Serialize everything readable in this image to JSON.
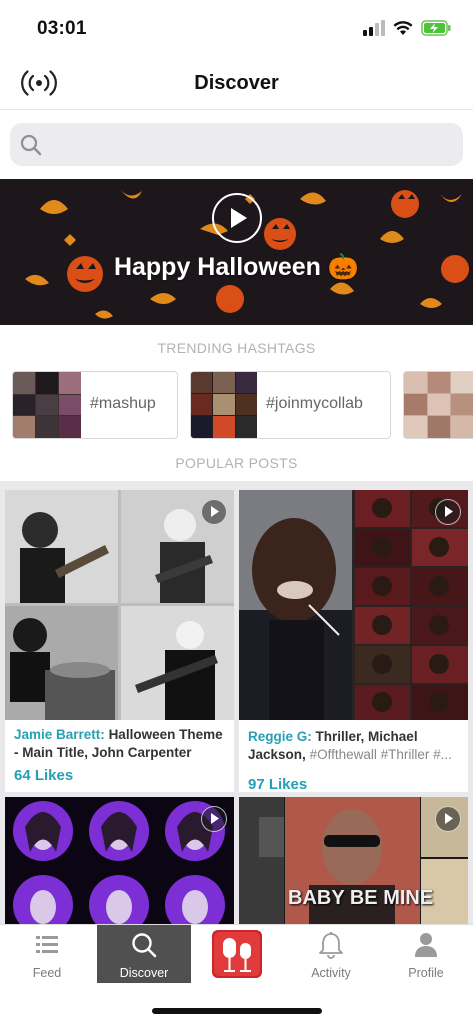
{
  "status": {
    "time": "03:01"
  },
  "nav": {
    "title": "Discover"
  },
  "search": {
    "placeholder": ""
  },
  "banner": {
    "title": "Happy Halloween 🎃"
  },
  "sections": {
    "trending": "TRENDING HASHTAGS",
    "popular": "POPULAR POSTS"
  },
  "hashtags": [
    {
      "tag": "#mashup"
    },
    {
      "tag": "#joinmycollab"
    }
  ],
  "posts": [
    {
      "user": "Jamie Barrett:",
      "title": "Halloween Theme - Main Title, John Carpenter",
      "tags": "",
      "likes": "64 Likes"
    },
    {
      "user": "Reggie G:",
      "title": "Thriller, Michael Jackson,",
      "tags": "#Offthewall #Thriller #...",
      "likes": "97 Likes"
    },
    {
      "user": "",
      "title": "",
      "tags": "",
      "likes": ""
    },
    {
      "user": "",
      "title": "BABY BE MINE",
      "tags": "",
      "likes": ""
    }
  ],
  "tabs": [
    {
      "label": "Feed",
      "icon": "list-icon"
    },
    {
      "label": "Discover",
      "icon": "search-icon"
    },
    {
      "label": "",
      "icon": "record-mic-icon"
    },
    {
      "label": "Activity",
      "icon": "bell-icon"
    },
    {
      "label": "Profile",
      "icon": "person-icon"
    }
  ],
  "colors": {
    "accent": "#27a0b5",
    "active_tab": "#505050",
    "record": "#c8262b"
  }
}
